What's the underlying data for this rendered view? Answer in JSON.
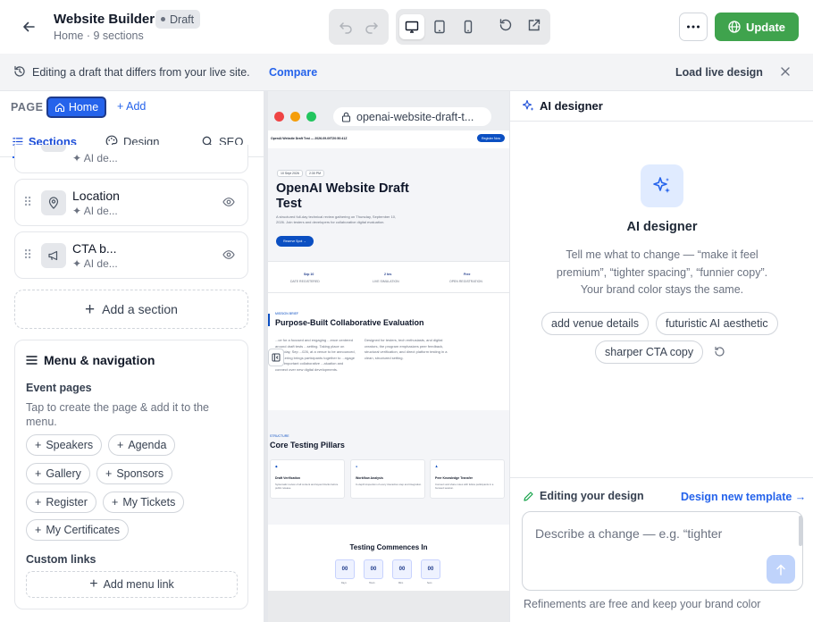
{
  "header": {
    "title": "Website Builder",
    "badge": "Draft",
    "subtitle": "Home · 9 sections",
    "update_label": "Update"
  },
  "banner": {
    "text": "Editing a draft that differs from your live site.",
    "compare": "Compare",
    "load_live": "Load live design"
  },
  "left": {
    "page_label": "PAGE",
    "home": "Home",
    "add": "Add",
    "tabs": [
      "Sections",
      "Design",
      "SEO"
    ],
    "active_tab": "Sections",
    "partial_card_sub": "✦ AI de...",
    "sections": [
      {
        "name": "Location",
        "sub": "✦ AI de..."
      },
      {
        "name": "CTA b...",
        "sub": "✦ AI de..."
      }
    ],
    "add_section": "Add a section",
    "menu": {
      "title": "Menu & navigation",
      "event_pages": "Event pages",
      "hint": "Tap to create the page & add it to the menu.",
      "chips": [
        "Speakers",
        "Agenda",
        "Gallery",
        "Sponsors",
        "Register",
        "My Tickets",
        "My Certificates"
      ],
      "custom_links": "Custom links",
      "add_menu_link": "Add menu link"
    }
  },
  "preview": {
    "url": "openai-website-draft-t...",
    "site": {
      "nav_title": "OpenAI Website Draft Test — 2026-09-09T20:50:41Z",
      "nav_button": "Register Now",
      "pills": [
        "10 Sept 2026",
        "2:30 PM"
      ],
      "hero_title": "OpenAI Website Draft Test",
      "hero_desc": "A structured full-day technical review gathering on Thursday, September 10, 2026. Join testers and developers for collaborative digital evaluation.",
      "hero_button": "Reserve Spot →",
      "stats": [
        {
          "value": "Sep 10",
          "label": "DATE REGISTERED"
        },
        {
          "value": "2 hrs",
          "label": "LIVE SIMULATION"
        },
        {
          "value": "Free",
          "label": "OPEN REGISTRATION"
        }
      ],
      "about_kicker": "MISSION BRIEF",
      "about_title": "Purpose-Built Collaborative Evaluation",
      "about_left": "...ce for a focused and engaging ...ence centered around draft tests ...setting. Taking place on Thursday, Sep ...026, at a venue to be announced, this ...ering brings participants together to ...ngage in an important collaborative ...aluation and connect over new digital developments.",
      "about_right": "Designed for testers, tech enthusiasts, and digital creators, the program emphasizes peer feedback, structural verification, and direct platform testing in a clean, structured setting.",
      "pillars_kicker": "STRUCTURE",
      "pillars_title": "Core Testing Pillars",
      "pillars": [
        {
          "title": "Draft Verification",
          "desc": "Systematic review of all content and layout blocks before public release."
        },
        {
          "title": "Workflow Analysis",
          "desc": "In-depth inspection of every interactive step and integration."
        },
        {
          "title": "Peer Knowledge Transfer",
          "desc": "Connect and share notes with fellow participants in a focused session."
        }
      ],
      "countdown_title": "Testing Commences In",
      "countdown": [
        {
          "value": "00",
          "label": "Days"
        },
        {
          "value": "00",
          "label": "Hours"
        },
        {
          "value": "00",
          "label": "Mins"
        },
        {
          "value": "00",
          "label": "Secs"
        }
      ]
    }
  },
  "right": {
    "header": "AI designer",
    "title": "AI designer",
    "desc": "Tell me what to change — “make it feel premium”, “tighter spacing”, “funnier copy”. Your brand color stays the same.",
    "suggestions": [
      "add venue details",
      "futuristic AI aesthetic",
      "sharper CTA copy"
    ],
    "editing": "Editing your design",
    "new_template": "Design new template →",
    "placeholder": "Describe a change — e.g. “tighter",
    "footer": "Refinements are free and keep your brand color"
  },
  "colors": {
    "accent": "#2563eb",
    "update_green": "#3fa34d",
    "site_navy": "#0b2a66"
  }
}
